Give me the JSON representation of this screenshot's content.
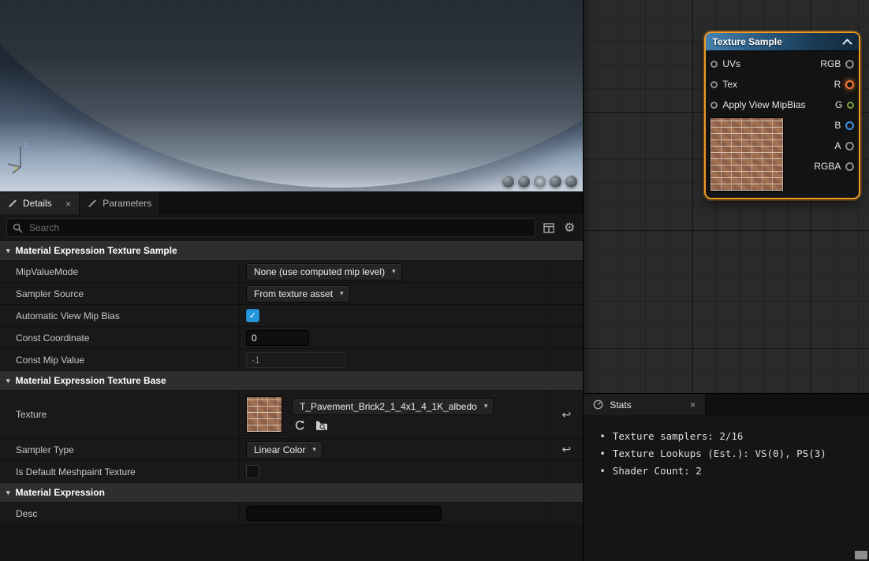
{
  "viewport": {
    "gizmo": {
      "z_label": "z",
      "x_label": "x"
    },
    "preview_shapes": [
      "cylinder",
      "sphere",
      "plane",
      "cube",
      "material-ball"
    ]
  },
  "details_panel": {
    "tabs": {
      "details": "Details",
      "parameters": "Parameters"
    },
    "search": {
      "placeholder": "Search"
    },
    "sections": {
      "texture_sample": {
        "title": "Material Expression Texture Sample",
        "rows": {
          "mip_value_mode": {
            "label": "MipValueMode",
            "value": "None (use computed mip level)"
          },
          "sampler_source": {
            "label": "Sampler Source",
            "value": "From texture asset"
          },
          "automatic_view_mip_bias": {
            "label": "Automatic View Mip Bias",
            "checked": true
          },
          "const_coordinate": {
            "label": "Const Coordinate",
            "value": "0"
          },
          "const_mip_value": {
            "label": "Const Mip Value",
            "value": "-1",
            "disabled": true
          }
        }
      },
      "texture_base": {
        "title": "Material Expression Texture Base",
        "rows": {
          "texture": {
            "label": "Texture",
            "value": "T_Pavement_Brick2_1_4x1_4_1K_albedo"
          },
          "sampler_type": {
            "label": "Sampler Type",
            "value": "Linear Color"
          },
          "is_default_meshpaint_texture": {
            "label": "Is Default Meshpaint Texture",
            "checked": false
          }
        }
      },
      "material_expression": {
        "title": "Material Expression",
        "rows": {
          "desc": {
            "label": "Desc",
            "value": ""
          }
        }
      }
    }
  },
  "graph": {
    "node": {
      "title": "Texture Sample",
      "inputs": [
        "UVs",
        "Tex",
        "Apply View MipBias"
      ],
      "outputs": [
        "RGB",
        "R",
        "G",
        "B",
        "A",
        "RGBA"
      ]
    }
  },
  "stats_panel": {
    "tab_label": "Stats",
    "bullet": "•",
    "lines": [
      "Texture samplers: 2/16",
      "Texture Lookups (Est.): VS(0), PS(3)",
      "Shader Count: 2"
    ]
  },
  "glyphs": {
    "close": "×",
    "dropdown_chevron": "▾",
    "section_triangle": "▾",
    "check": "✓",
    "reset_arrow": "↩"
  },
  "colors": {
    "selection_orange": "#ef9b22",
    "accent_blue": "#2596db",
    "pin_r": "#ff7a2f",
    "pin_g": "#79a33e",
    "pin_b": "#3f8fd9"
  }
}
